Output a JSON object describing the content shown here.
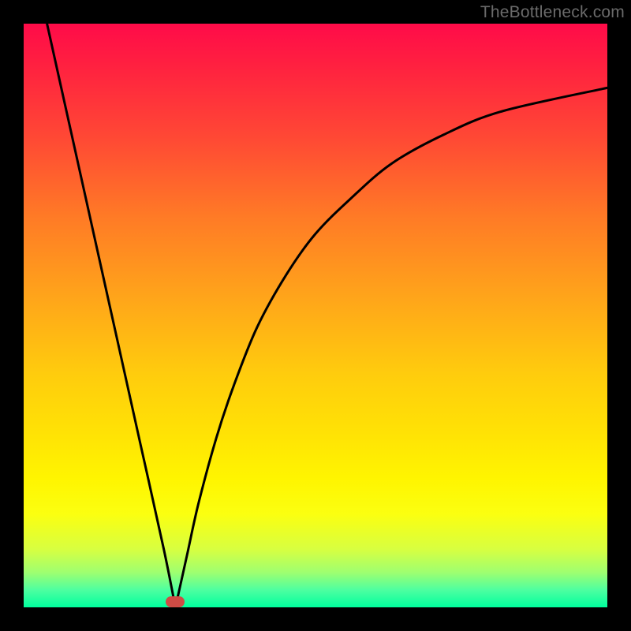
{
  "watermark": "TheBottleneck.com",
  "chart_data": {
    "type": "line",
    "title": "",
    "xlabel": "",
    "ylabel": "",
    "xlim": [
      0,
      100
    ],
    "ylim": [
      0,
      100
    ],
    "series": [
      {
        "name": "left-branch",
        "x": [
          4,
          8,
          12,
          16,
          20,
          24,
          26
        ],
        "values": [
          100,
          82,
          64,
          46,
          28,
          10,
          0
        ]
      },
      {
        "name": "right-branch",
        "x": [
          26,
          28,
          30,
          33,
          36,
          40,
          45,
          50,
          56,
          63,
          72,
          82,
          100
        ],
        "values": [
          0,
          9,
          18,
          29,
          38,
          48,
          57,
          64,
          70,
          76,
          81,
          85,
          89
        ]
      }
    ],
    "marker": {
      "x": 26,
      "y": 1
    },
    "background_gradient": {
      "top": "#ff0b49",
      "mid": "#ffe205",
      "bottom": "#00ff9e"
    }
  }
}
